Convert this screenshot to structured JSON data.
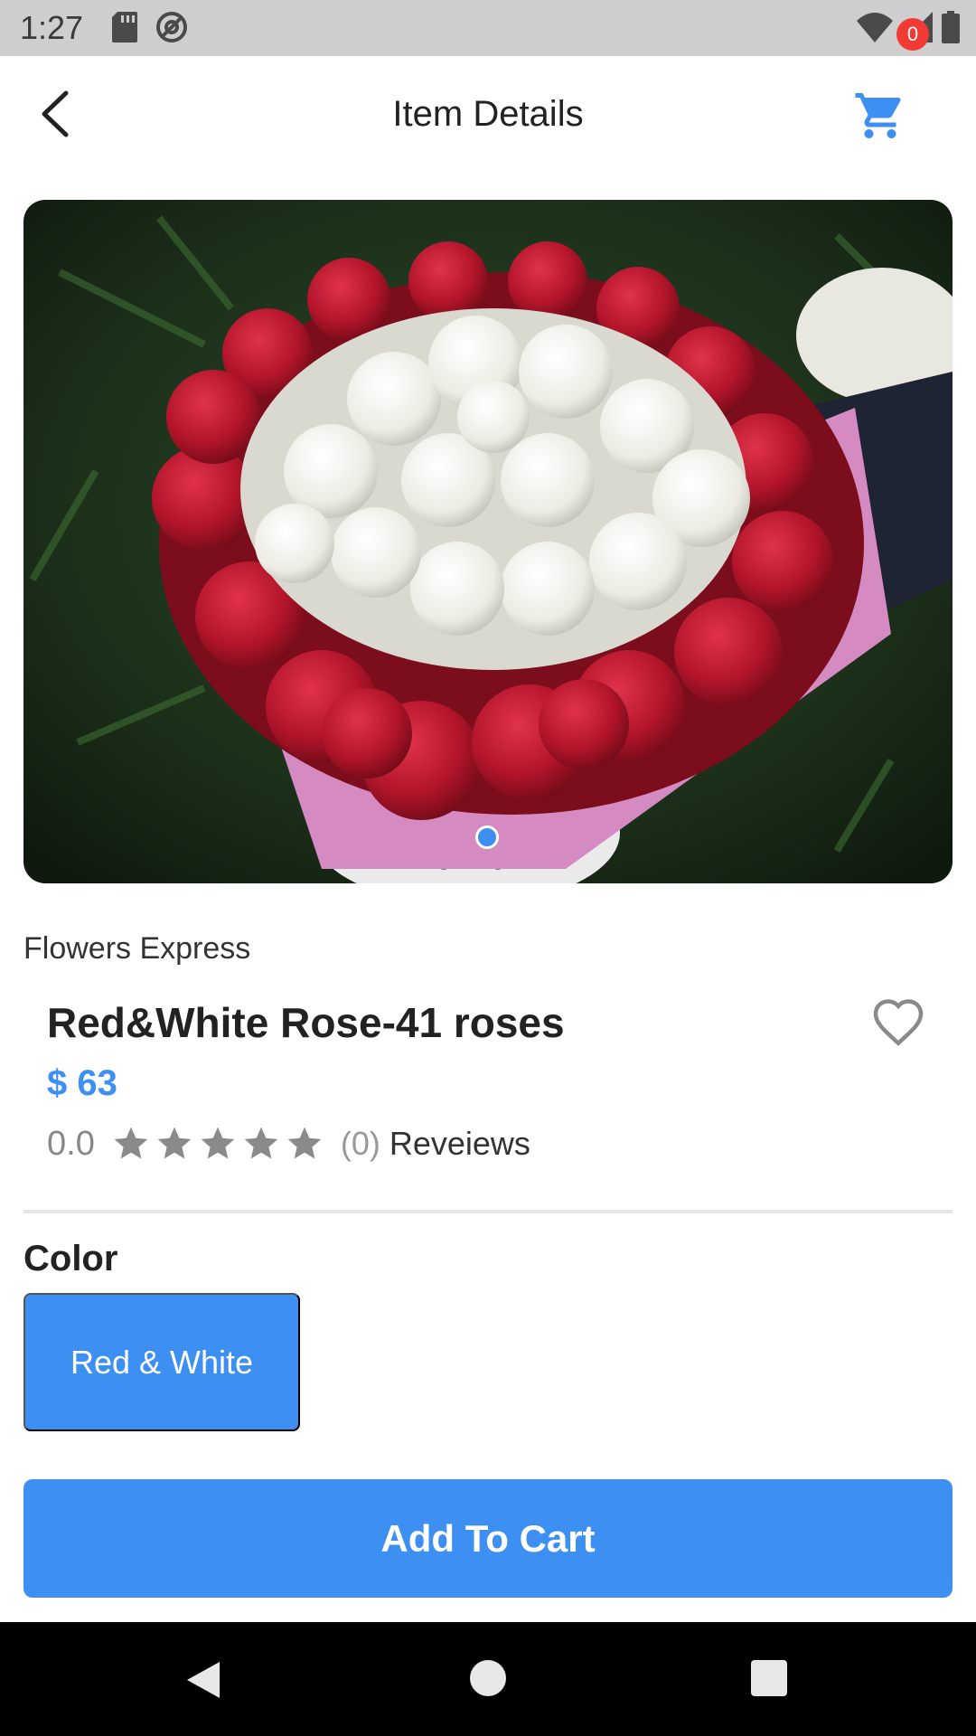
{
  "status_bar": {
    "time": "1:27",
    "icons": [
      "sd-card-icon",
      "at-sign-icon",
      "wifi-icon",
      "signal-icon",
      "battery-icon"
    ]
  },
  "app_bar": {
    "title": "Item Details",
    "back_icon": "back-arrow-icon",
    "cart_icon": "shopping-cart-icon",
    "cart_count": "0"
  },
  "product": {
    "image_desc": "bouquet-image",
    "store_name": "Flowers Express",
    "name": "Red&White Rose-41 roses",
    "price": "$ 63",
    "rating_value": "0.0",
    "stars_filled": 0,
    "stars_total": 5,
    "review_count": "(0)",
    "review_label": "Reveiews"
  },
  "options": {
    "color_heading": "Color",
    "colors": [
      "Red & White"
    ],
    "selected_color": "Red & White"
  },
  "actions": {
    "add_to_cart_label": "Add To Cart"
  },
  "colors": {
    "accent": "#3d8ff2",
    "badge": "#f23a35",
    "status_bar_bg": "#cfcdd0",
    "nav_bar_bg": "#000000"
  }
}
